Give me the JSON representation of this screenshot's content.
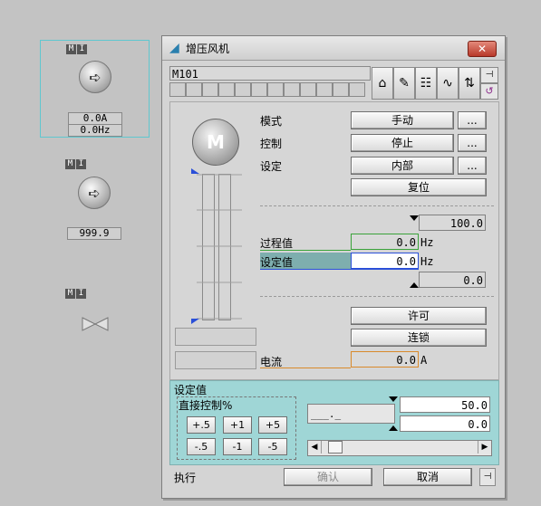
{
  "left_panel": {
    "mi_m": "M",
    "mi_i": "I",
    "motor1": {
      "icon": "arrow-right-icon",
      "value_a": "0.0A",
      "value_hz": "0.0Hz"
    },
    "motor2": {
      "icon": "arrow-right-icon",
      "value": "999.9"
    },
    "valve": {
      "icon": "valve-icon"
    }
  },
  "dialog": {
    "title": "增压风机",
    "close_label": "✕",
    "tag": "M101",
    "motor_symbol": "M",
    "rows": {
      "mode_label": "模式",
      "mode_value": "手动",
      "control_label": "控制",
      "control_value": "停止",
      "setting_label": "设定",
      "setting_value": "内部",
      "reset_label": "复位",
      "ellipsis": "..."
    },
    "scale_max": "100.0",
    "scale_min": "0.0",
    "process_label": "过程值",
    "process_value": "0.0",
    "process_unit": "Hz",
    "setpoint_label": "设定值",
    "setpoint_value": "0.0",
    "setpoint_unit": "Hz",
    "permit_label": "许可",
    "interlock_label": "连锁",
    "current_label": "电流",
    "current_value": "0.0",
    "current_unit": "A",
    "bottom": {
      "title": "设定值",
      "direct_label": "直接控制%",
      "buttons": [
        "+.5",
        "+1",
        "+5",
        "-.5",
        "-1",
        "-5"
      ],
      "input_placeholder": "___._",
      "max_value": "50.0",
      "min_value": "0.0",
      "slider_position": 0.05
    },
    "footer": {
      "execute_label": "执行",
      "confirm_label": "确认",
      "cancel_label": "取消"
    },
    "colors": {
      "accent_green": "#3aa33a",
      "accent_blue": "#2a4fd8",
      "accent_orange": "#d98a2b",
      "teal": "#9fd6d6"
    }
  }
}
